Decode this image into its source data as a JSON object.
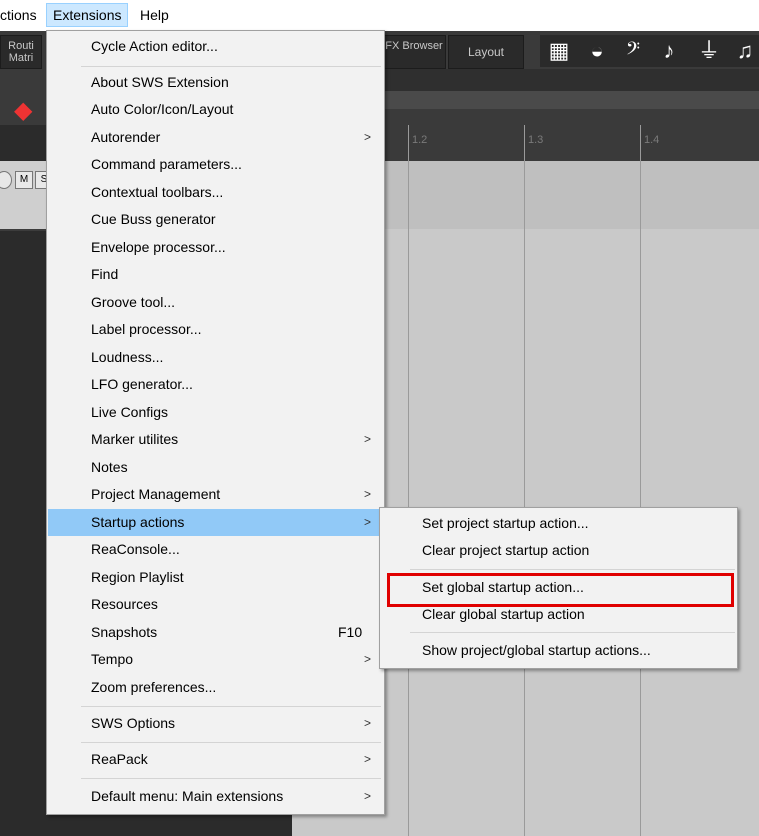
{
  "menubar": {
    "actions": "ctions",
    "extensions": "Extensions",
    "help": "Help"
  },
  "toolbar": {
    "routing": "Routi Matri",
    "fx": "FX Browser",
    "layout": "Layout",
    "icons": [
      "grid-icon",
      "drum-icon",
      "bass-clef-icon",
      "guitar-icon",
      "microphone-icon",
      "guitar-icon"
    ]
  },
  "track": {
    "mute": "M",
    "solo": "S"
  },
  "ruler": [
    "1.2",
    "1.3",
    "1.4"
  ],
  "menu": {
    "items": [
      {
        "label": "Cycle Action editor...",
        "arrow": "",
        "shortcut": ""
      },
      {
        "label": "About SWS Extension",
        "arrow": "",
        "shortcut": ""
      },
      {
        "label": "Auto Color/Icon/Layout",
        "arrow": "",
        "shortcut": ""
      },
      {
        "label": "Autorender",
        "arrow": ">",
        "shortcut": ""
      },
      {
        "label": "Command parameters...",
        "arrow": "",
        "shortcut": ""
      },
      {
        "label": "Contextual toolbars...",
        "arrow": "",
        "shortcut": ""
      },
      {
        "label": "Cue Buss generator",
        "arrow": "",
        "shortcut": ""
      },
      {
        "label": "Envelope processor...",
        "arrow": "",
        "shortcut": ""
      },
      {
        "label": "Find",
        "arrow": "",
        "shortcut": ""
      },
      {
        "label": "Groove tool...",
        "arrow": "",
        "shortcut": ""
      },
      {
        "label": "Label processor...",
        "arrow": "",
        "shortcut": ""
      },
      {
        "label": "Loudness...",
        "arrow": "",
        "shortcut": ""
      },
      {
        "label": "LFO generator...",
        "arrow": "",
        "shortcut": ""
      },
      {
        "label": "Live Configs",
        "arrow": "",
        "shortcut": ""
      },
      {
        "label": "Marker utilites",
        "arrow": ">",
        "shortcut": ""
      },
      {
        "label": "Notes",
        "arrow": "",
        "shortcut": ""
      },
      {
        "label": "Project Management",
        "arrow": ">",
        "shortcut": ""
      },
      {
        "label": "Startup actions",
        "arrow": ">",
        "shortcut": ""
      },
      {
        "label": "ReaConsole...",
        "arrow": "",
        "shortcut": ""
      },
      {
        "label": "Region Playlist",
        "arrow": "",
        "shortcut": ""
      },
      {
        "label": "Resources",
        "arrow": "",
        "shortcut": ""
      },
      {
        "label": "Snapshots",
        "arrow": "",
        "shortcut": "F10"
      },
      {
        "label": "Tempo",
        "arrow": ">",
        "shortcut": ""
      },
      {
        "label": "Zoom preferences...",
        "arrow": "",
        "shortcut": ""
      },
      {
        "label": "SWS Options",
        "arrow": ">",
        "shortcut": ""
      },
      {
        "label": "ReaPack",
        "arrow": ">",
        "shortcut": ""
      },
      {
        "label": "Default menu: Main extensions",
        "arrow": ">",
        "shortcut": ""
      }
    ]
  },
  "submenu": {
    "items": [
      {
        "label": "Set project startup action..."
      },
      {
        "label": "Clear project startup action"
      },
      {
        "label": "Set global startup action..."
      },
      {
        "label": "Clear global startup action"
      },
      {
        "label": "Show project/global startup actions..."
      }
    ]
  },
  "colors": {
    "highlight": "#91c9f7",
    "annotation": "#e00000"
  }
}
